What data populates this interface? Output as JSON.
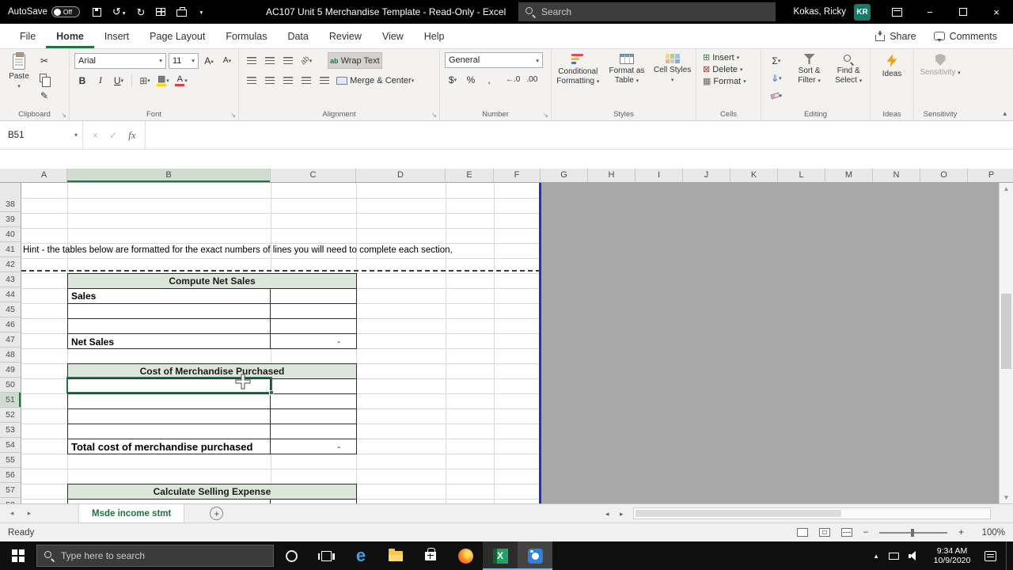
{
  "glyphs": {
    "caret_down": "▾",
    "caret_up": "▴",
    "tri_left": "◂",
    "tri_right": "▸",
    "scroll_up": "▲",
    "scroll_down": "▼",
    "undo": "↺",
    "redo": "↻",
    "minimize": "−",
    "close": "×",
    "cancel": "×",
    "check": "✓",
    "plus": "+",
    "scissors": "✂",
    "format_painter": "✎",
    "borders": "⊞",
    "fill_down": "⇓",
    "letter_a": "A",
    "orientation": "ab",
    "insert": "⊞",
    "delete": "⊠",
    "format": "▦",
    "launcher": "↘",
    "collapse": "▴",
    "zoom_out": "−",
    "zoom_in": "+",
    "excel_x": "X"
  },
  "titlebar": {
    "autosave_label": "AutoSave",
    "autosave_state": "Off",
    "title": "AC107 Unit 5 Merchandise Template  -  Read-Only  -  Excel",
    "search_placeholder": "Search",
    "user_name": "Kokas, Ricky",
    "user_initials": "KR"
  },
  "ribbon": {
    "tabs": [
      "File",
      "Home",
      "Insert",
      "Page Layout",
      "Formulas",
      "Data",
      "Review",
      "View",
      "Help"
    ],
    "active_tab": "Home",
    "share": "Share",
    "comments": "Comments",
    "clipboard": {
      "label": "Clipboard",
      "paste": "Paste"
    },
    "font": {
      "label": "Font",
      "family": "Arial",
      "size": "11",
      "bold": "B",
      "italic": "I",
      "underline": "U"
    },
    "alignment": {
      "label": "Alignment",
      "wrap_text": "Wrap Text",
      "merge_center": "Merge & Center"
    },
    "number": {
      "label": "Number",
      "format": "General",
      "currency": "$",
      "percent": "%",
      "comma": ",",
      "inc_decimal": "←.0",
      "dec_decimal": ".00"
    },
    "styles": {
      "label": "Styles",
      "conditional": "Conditional Formatting",
      "format_table": "Format as Table",
      "cell_styles": "Cell Styles"
    },
    "cells": {
      "label": "Cells",
      "insert": "Insert",
      "delete": "Delete",
      "format": "Format"
    },
    "editing": {
      "label": "Editing",
      "autosum": "Σ",
      "sort_filter": "Sort & Filter",
      "find_select": "Find & Select"
    },
    "ideas": {
      "label": "Ideas",
      "button": "Ideas"
    },
    "sensitivity": {
      "label": "Sensitivity",
      "button": "Sensitivity"
    }
  },
  "formula_bar": {
    "name_box": "B51",
    "fx": "fx",
    "value": ""
  },
  "grid": {
    "selected_cell": "B51",
    "columns": [
      "A",
      "B",
      "C",
      "D",
      "E",
      "F",
      "G",
      "H",
      "I",
      "J",
      "K",
      "L",
      "M",
      "N",
      "O",
      "P"
    ],
    "first_row": 38,
    "last_row": 58,
    "hint": {
      "cell": "A42",
      "text": "Hint - the tables below are formatted for the exact numbers of lines you will need to complete  each section,"
    },
    "tables": [
      {
        "title": "Compute Net Sales",
        "header_row": 44,
        "rows": [
          {
            "row": 45,
            "label": "Sales",
            "value": ""
          },
          {
            "row": 46,
            "label": "",
            "value": ""
          },
          {
            "row": 47,
            "label": "",
            "value": ""
          },
          {
            "row": 48,
            "label": "Net Sales",
            "value": "-"
          }
        ]
      },
      {
        "title": "Cost of Merchandise Purchased",
        "header_row": 50,
        "rows": [
          {
            "row": 51,
            "label": "",
            "value": ""
          },
          {
            "row": 52,
            "label": "",
            "value": ""
          },
          {
            "row": 53,
            "label": "",
            "value": ""
          },
          {
            "row": 54,
            "label": "",
            "value": ""
          },
          {
            "row": 55,
            "label": "Total cost of merchandise purchased",
            "value": "-",
            "emphasis": true
          }
        ]
      },
      {
        "title": "Calculate Selling Expense",
        "header_row": 58,
        "rows": [
          {
            "row": 59,
            "label": "",
            "value": ""
          }
        ]
      }
    ]
  },
  "sheet_tabs": {
    "tabs": [
      {
        "name": "Msde income stmt",
        "active": true
      }
    ]
  },
  "status_bar": {
    "mode": "Ready",
    "zoom": "100%"
  },
  "taskbar": {
    "search_placeholder": "Type here to search",
    "time": "9:34 AM",
    "date": "10/9/2020"
  },
  "colors": {
    "accent_green": "#217346",
    "table_header_fill": "#dde6da",
    "page_break_blue": "#2331b8",
    "offsheet_gray": "#a8a8a8"
  }
}
